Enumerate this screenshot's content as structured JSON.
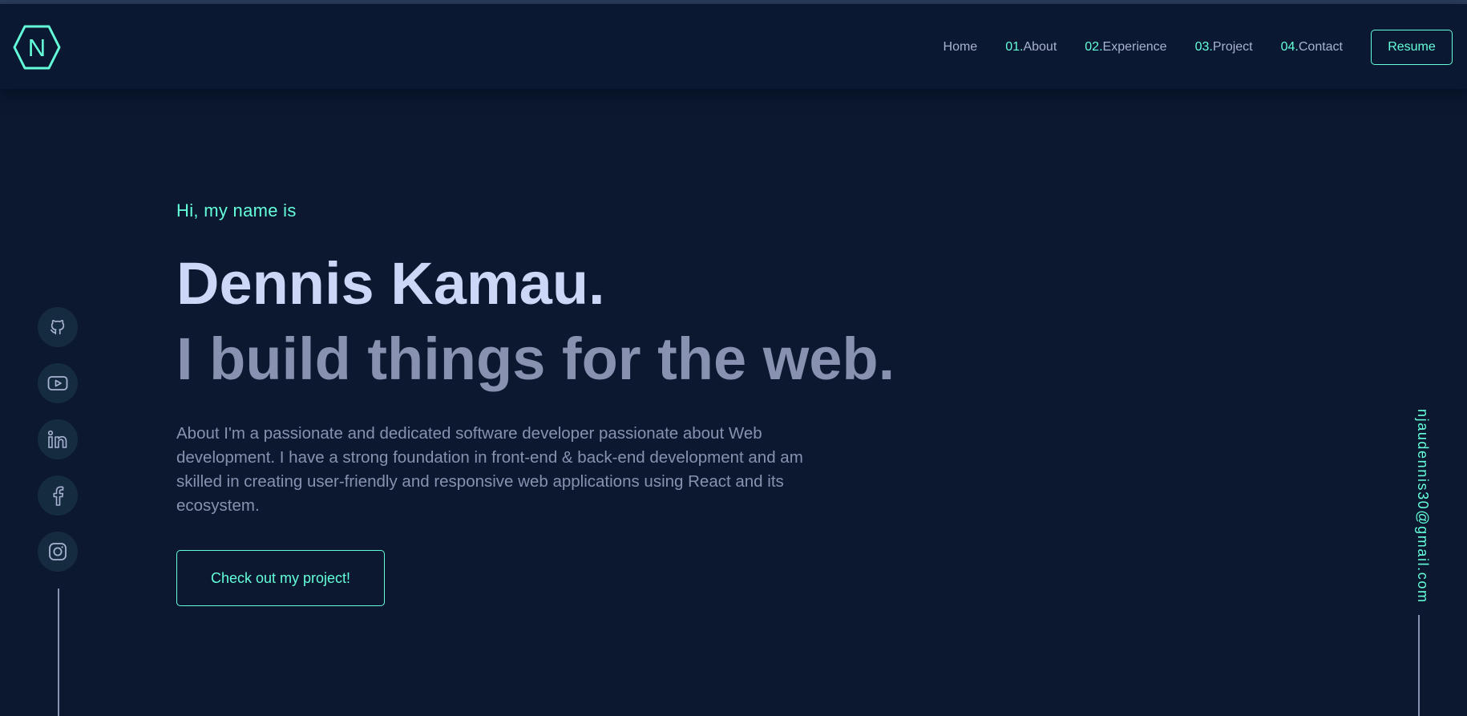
{
  "header": {
    "logo_letter": "N",
    "nav": [
      {
        "num": "",
        "label": "Home"
      },
      {
        "num": "01.",
        "label": "About"
      },
      {
        "num": "02.",
        "label": "Experience"
      },
      {
        "num": "03.",
        "label": "Project"
      },
      {
        "num": "04.",
        "label": "Contact"
      }
    ],
    "resume_label": "Resume"
  },
  "hero": {
    "greeting": "Hi, my name is",
    "name": "Dennis Kamau.",
    "tagline": "I build things for the web.",
    "about": "About I'm a passionate and dedicated software developer passionate about Web development. I have a strong foundation in front-end & back-end development and am skilled in creating user-friendly and responsive web applications using React and its ecosystem.",
    "cta_label": "Check out my project!"
  },
  "social": [
    {
      "icon": "github-icon"
    },
    {
      "icon": "youtube-icon"
    },
    {
      "icon": "linkedin-icon"
    },
    {
      "icon": "facebook-icon"
    },
    {
      "icon": "instagram-icon"
    }
  ],
  "email": "njaudennis30@gmail.com",
  "colors": {
    "background": "#0b1830",
    "accent": "#64ffda",
    "heading": "#ccd6f6",
    "body_text": "#8892b0",
    "social_button": "#152c40"
  }
}
